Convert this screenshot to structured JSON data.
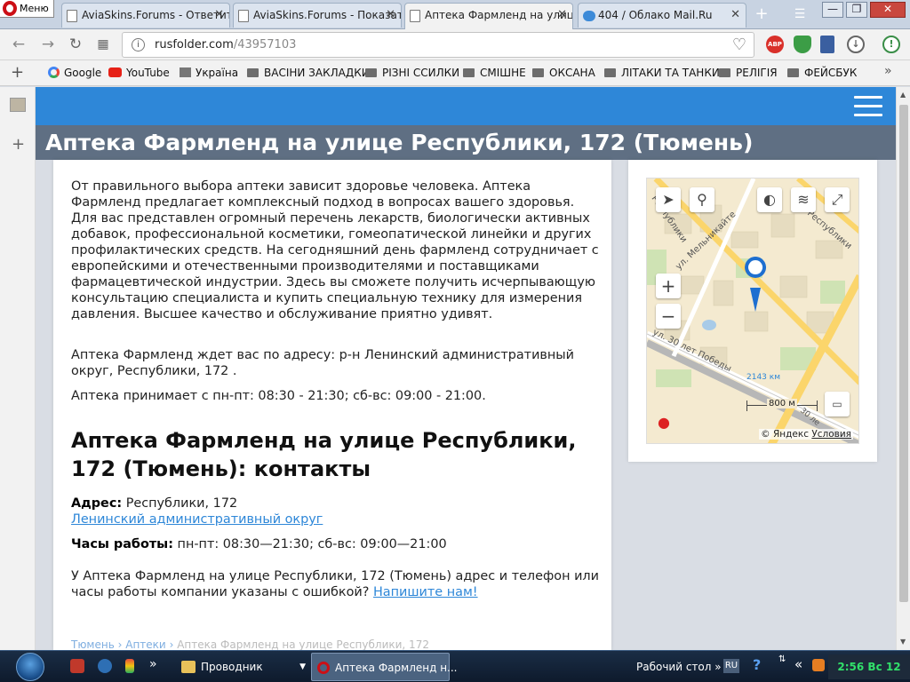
{
  "browser": {
    "menu_label": "Меню",
    "tabs": [
      {
        "title": "AviaSkins.Forums - Ответить",
        "icon": "page-icon"
      },
      {
        "title": "AviaSkins.Forums - Показать",
        "icon": "page-icon"
      },
      {
        "title": "Аптека Фармленд на улице",
        "icon": "page-icon",
        "active": true
      },
      {
        "title": "404 / Облако Mail.Ru",
        "icon": "cloud-icon"
      }
    ],
    "url_domain": "rusfolder.com",
    "url_path": "/43957103",
    "ext_abp": "ABP",
    "bookmarks": [
      "Google",
      "YouTube",
      "Україна",
      "ВАСІНИ ЗАКЛАДКИ",
      "РІЗНІ ССИЛКИ",
      "СМІШНЕ",
      "ОКСАНА",
      "ЛІТАКИ ТА ТАНКИ",
      "РЕЛІГІЯ",
      "ФЕЙСБУК"
    ]
  },
  "page": {
    "title": "Аптека Фармленд на улице Республики, 172 (Тюмень)",
    "intro": "От правильного выбора аптеки зависит здоровье человека. Аптека Фармленд предлагает комплексный подход в вопросах вашего здоровья. Для вас представлен огромный перечень лекарств, биологически активных добавок, профессиональной косметики, гомеопатической линейки и других профилактических средств. На сегодняшний день фармленд сотрудничает с европейскими и отечественными производителями и поставщиками фармацевтической индустрии. Здесь вы сможете получить исчерпывающую консультацию специалиста и купить специальную технику для измерения давления. Высшее качество и обслуживание приятно удивят.",
    "address_para": "Аптека Фармленд ждет вас по адресу: р-н Ленинский административный округ, Республики, 172 .",
    "hours_para": "Аптека принимает с пн-пт: 08:30 - 21:30; сб-вс: 09:00 - 21:00.",
    "contacts_heading": "Аптека Фармленд на улице Республики, 172 (Тюмень): контакты",
    "address_label": "Адрес:",
    "address_value": "Республики, 172",
    "district_link": "Ленинский административный округ",
    "hours_label": "Часы работы:",
    "hours_value": "пн-пт: 08:30—21:30; сб-вс: 09:00—21:00",
    "error_text": "У Аптека Фармленд на улице Республики, 172 (Тюмень) адрес и телефон или часы работы компании указаны с ошибкой?",
    "error_link": "Напишите нам!",
    "breadcrumbs": [
      "Тюмень",
      "Аптеки",
      "Аптека Фармленд на улице Республики, 172"
    ]
  },
  "map": {
    "street1": "ул. Мельникайте",
    "street2": "ул. 30 лет Победы",
    "street3": "Республики",
    "street4": "Республики",
    "km_label": "2143 км",
    "scale": "800 м",
    "copyright": "© Яндекс",
    "terms_link": "Условия",
    "label_30le": "30 ле"
  },
  "taskbar": {
    "explorer_label": "Проводник",
    "browser_task": "Аптека Фармленд н...",
    "desktop_label": "Рабочий стол",
    "lang": "RU",
    "clock": "2:56 Вс 12"
  },
  "colors": {
    "site_blue": "#2e87d8",
    "title_bar": "#5f6f83"
  }
}
